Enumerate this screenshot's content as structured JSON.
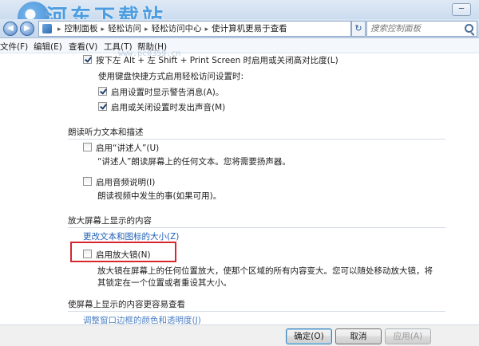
{
  "watermark": {
    "text": "河东下载站",
    "url": "www.pc0359.cn"
  },
  "window": {
    "minimize_glyph": "─"
  },
  "address": {
    "back_glyph": "◀",
    "forward_glyph": "▶",
    "crumbs": [
      "控制面板",
      "轻松访问",
      "轻松访问中心",
      "使计算机更易于查看"
    ],
    "separator": "▸",
    "refresh_glyph": "↻"
  },
  "search": {
    "placeholder": "搜索控制面板"
  },
  "menu": {
    "items": [
      "文件(F)",
      "编辑(E)",
      "查看(V)",
      "工具(T)",
      "帮助(H)"
    ]
  },
  "content": {
    "high_contrast_toggle": {
      "checked": true,
      "label": "按下左 Alt + 左 Shift + Print Screen 时启用或关闭高对比度(L)"
    },
    "shortcut_settings_label": "使用键盘快捷方式启用轻松访问设置时:",
    "warning_option": {
      "checked": true,
      "label": "启用设置时显示警告消息(A)。"
    },
    "sound_option": {
      "checked": true,
      "label": "启用或关闭设置时发出声音(M)"
    },
    "narrator_section": {
      "title": "朗读听力文本和描述",
      "narrator": {
        "checked": false,
        "label": "启用“讲述人”(U)",
        "description": "“讲述人”朗读屏幕上的任何文本。您将需要扬声器。"
      },
      "audio_description": {
        "checked": false,
        "label": "启用音频说明(I)",
        "description": "朗读视频中发生的事(如果可用)。"
      }
    },
    "magnify_section": {
      "title": "放大屏幕上显示的内容",
      "resize_link": "更改文本和图标的大小(Z)",
      "magnifier": {
        "checked": false,
        "label": "启用放大镜(N)",
        "description": "放大镜在屏幕上的任何位置放大，使那个区域的所有内容变大。您可以随处移动放大镜，将其锁定在一个位置或者重设其大小。"
      }
    },
    "easier_section": {
      "title": "使屏幕上显示的内容更容易查看",
      "border_link": "调整窗口边框的颜色和透明度(J)"
    }
  },
  "footer": {
    "ok_label": "确定(O)",
    "cancel_label": "取消",
    "apply_label": "应用(A)"
  },
  "colors": {
    "highlight": "#d8262f",
    "link": "#1f5fb3"
  }
}
